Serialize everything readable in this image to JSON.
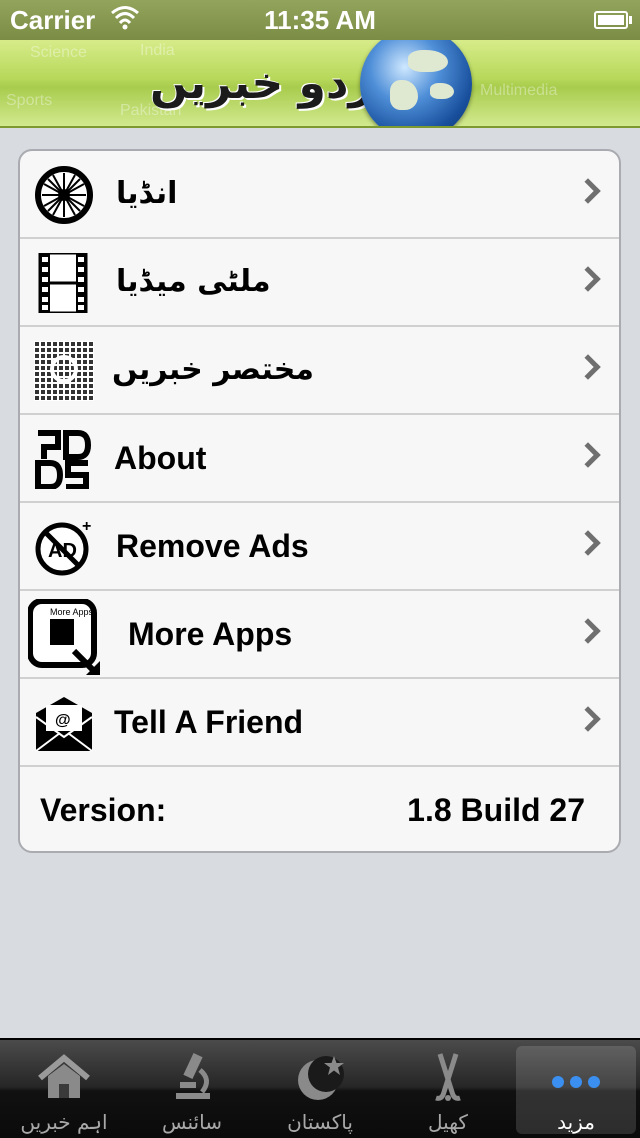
{
  "status_bar": {
    "carrier": "Carrier",
    "time": "11:35 AM"
  },
  "header": {
    "logo_text": "اردو خبریں",
    "bg_words": [
      "Science",
      "India",
      "Sports",
      "Pakistan",
      "Multimedia"
    ]
  },
  "menu": {
    "items": [
      {
        "label": "انڈیا",
        "icon": "india-chakra-icon"
      },
      {
        "label": "ملٹی میڈیا",
        "icon": "film-strip-icon"
      },
      {
        "label": "مختصر خبریں",
        "icon": "news-grid-icon"
      },
      {
        "label": "About",
        "icon": "pd-logo-icon"
      },
      {
        "label": "Remove Ads",
        "icon": "no-ads-icon"
      },
      {
        "label": "More Apps",
        "icon": "more-apps-icon",
        "icon_text": "More Apps"
      },
      {
        "label": "Tell A Friend",
        "icon": "mail-envelope-icon"
      }
    ],
    "version_label": "Version:",
    "version_value": "1.8 Build 27"
  },
  "tabbar": {
    "tabs": [
      {
        "label": "اہم خبریں",
        "icon": "home-icon",
        "active": false
      },
      {
        "label": "سائنس",
        "icon": "microscope-icon",
        "active": false
      },
      {
        "label": "پاکستان",
        "icon": "crescent-star-icon",
        "active": false
      },
      {
        "label": "کھیل",
        "icon": "hockey-sticks-icon",
        "active": false
      },
      {
        "label": "مزید",
        "icon": "more-dots-icon",
        "active": true
      }
    ]
  },
  "colors": {
    "header_green": "#b7d85a",
    "active_dots": "#3a8ff0"
  }
}
